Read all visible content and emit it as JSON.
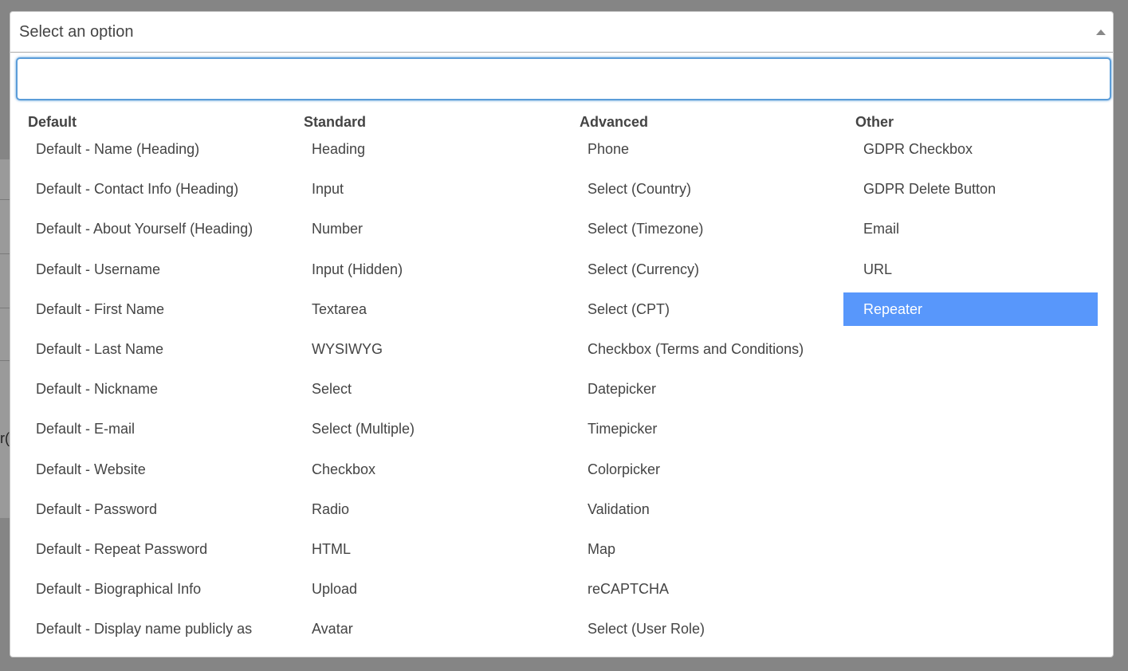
{
  "select": {
    "label": "Select an option",
    "search_value": ""
  },
  "backdrop": {
    "partial_text": "r("
  },
  "groups": [
    {
      "title": "Default",
      "options": [
        "Default - Name (Heading)",
        "Default - Contact Info (Heading)",
        "Default - About Yourself (Heading)",
        "Default - Username",
        "Default - First Name",
        "Default - Last Name",
        "Default - Nickname",
        "Default - E-mail",
        "Default - Website",
        "Default - Password",
        "Default - Repeat Password",
        "Default - Biographical Info",
        "Default - Display name publicly as"
      ]
    },
    {
      "title": "Standard",
      "options": [
        "Heading",
        "Input",
        "Number",
        "Input (Hidden)",
        "Textarea",
        "WYSIWYG",
        "Select",
        "Select (Multiple)",
        "Checkbox",
        "Radio",
        "HTML",
        "Upload",
        "Avatar"
      ]
    },
    {
      "title": "Advanced",
      "options": [
        "Phone",
        "Select (Country)",
        "Select (Timezone)",
        "Select (Currency)",
        "Select (CPT)",
        "Checkbox (Terms and Conditions)",
        "Datepicker",
        "Timepicker",
        "Colorpicker",
        "Validation",
        "Map",
        "reCAPTCHA",
        "Select (User Role)"
      ]
    },
    {
      "title": "Other",
      "options": [
        "GDPR Checkbox",
        "GDPR Delete Button",
        "Email",
        "URL",
        "Repeater"
      ]
    }
  ],
  "highlighted": {
    "group": 3,
    "option": 4
  },
  "colors": {
    "highlight": "#5897fb",
    "focus_border": "#5b9dd9"
  }
}
